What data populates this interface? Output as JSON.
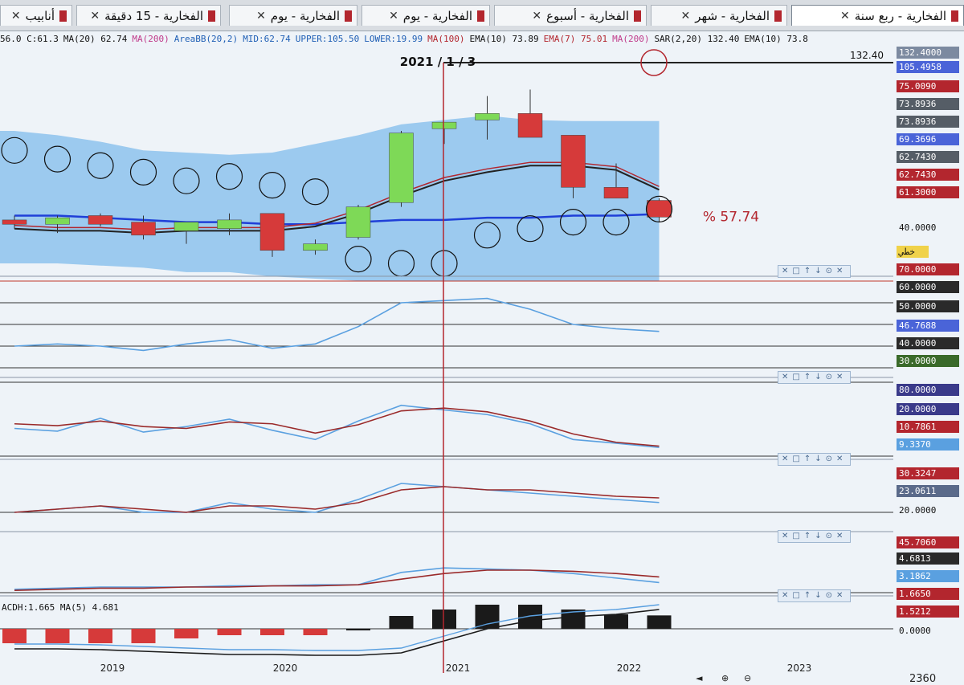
{
  "tabs": [
    {
      "label": "الفخارية - ربع سنة",
      "active": true
    },
    {
      "label": "الفخارية - شهر"
    },
    {
      "label": "الفخارية - أسبوع"
    },
    {
      "label": "الفخارية - يوم"
    },
    {
      "label": "الفخارية - يوم"
    },
    {
      "label": "الفخارية - 15 دقيقة"
    },
    {
      "label": "أنابيب"
    }
  ],
  "infobar": [
    {
      "text": "56.0 C:61.3",
      "color": "#111111"
    },
    {
      "text": "MA(20) 62.74",
      "color": "#111111"
    },
    {
      "text": "MA(200)",
      "color": "#c03a8a"
    },
    {
      "text": "AreaBB(20,2)",
      "color": "#1f5fb5"
    },
    {
      "text": "MID:62.74",
      "color": "#1f5fb5"
    },
    {
      "text": "UPPER:105.50",
      "color": "#1f5fb5"
    },
    {
      "text": "LOWER:19.99",
      "color": "#1f5fb5"
    },
    {
      "text": "MA(100)",
      "color": "#b3262e"
    },
    {
      "text": "EMA(10) 73.89",
      "color": "#111111"
    },
    {
      "text": "EMA(7) 75.01",
      "color": "#b3262e"
    },
    {
      "text": "MA(200)",
      "color": "#c03a8a"
    },
    {
      "text": "SAR(2,20) 132.40",
      "color": "#111111"
    },
    {
      "text": "EMA(10) 73.8",
      "color": "#111111"
    }
  ],
  "annotations": {
    "date_marker": "2021 / 1 / 3",
    "hline_value": "132.40",
    "percent": "% 57.74",
    "line_tool": "خطي"
  },
  "bottom": {
    "value": "2360"
  },
  "colors": {
    "bull": "#7ed957",
    "bear": "#d63a3a",
    "band": "#5aa8e8",
    "cursor": "#b3262e"
  },
  "chart_data": [
    {
      "type": "candlestick",
      "title": "الفخارية - ربع سنة",
      "x": [
        "2019",
        "2020",
        "2021",
        "2022",
        "2023"
      ],
      "ylim": [
        40,
        132.4
      ],
      "candles": [
        {
          "o": 60,
          "h": 62,
          "l": 56,
          "c": 58
        },
        {
          "o": 58,
          "h": 62,
          "l": 54,
          "c": 61
        },
        {
          "o": 62,
          "h": 63,
          "l": 57,
          "c": 58
        },
        {
          "o": 59,
          "h": 62,
          "l": 51,
          "c": 53
        },
        {
          "o": 55,
          "h": 57,
          "l": 49,
          "c": 59
        },
        {
          "o": 56,
          "h": 63,
          "l": 53,
          "c": 60
        },
        {
          "o": 63,
          "h": 63,
          "l": 43,
          "c": 46
        },
        {
          "o": 46,
          "h": 51,
          "l": 44,
          "c": 49
        },
        {
          "o": 52,
          "h": 67,
          "l": 51,
          "c": 66
        },
        {
          "o": 68,
          "h": 101,
          "l": 66,
          "c": 100
        },
        {
          "o": 102,
          "h": 104,
          "l": 95,
          "c": 105
        },
        {
          "o": 106,
          "h": 117,
          "l": 97,
          "c": 109
        },
        {
          "o": 109,
          "h": 120,
          "l": 100,
          "c": 98
        },
        {
          "o": 99,
          "h": 99,
          "l": 70,
          "c": 75
        },
        {
          "o": 75,
          "h": 86,
          "l": 70,
          "c": 70
        },
        {
          "o": 69,
          "h": 70,
          "l": 59,
          "c": 61.3
        }
      ],
      "sar": [
        92,
        88,
        85,
        82,
        78,
        80,
        76,
        73,
        42,
        40,
        40,
        53,
        56,
        59,
        59,
        65
      ],
      "bb_upper": [
        101,
        99,
        96,
        92,
        91,
        90,
        91,
        95,
        99,
        104,
        106,
        108,
        106,
        105.5,
        105.5,
        105.5
      ],
      "bb_lower": [
        40,
        40,
        39,
        38,
        36,
        36,
        34,
        33,
        32,
        32,
        32,
        32,
        32,
        32,
        32,
        32
      ],
      "ema10": [
        56,
        55,
        55,
        54,
        55,
        55,
        55,
        57,
        63,
        71,
        78,
        82,
        85,
        85,
        83,
        73.89
      ],
      "ma200": [
        62,
        62,
        61,
        60,
        59,
        59,
        58,
        58,
        59,
        60,
        60,
        61,
        61,
        62,
        62,
        62.74
      ],
      "labels": [
        "132.4000",
        "105.4958",
        "75.0090",
        "73.8936",
        "73.8936",
        "69.3696",
        "62.7430",
        "62.7430",
        "61.3000",
        "40.0000"
      ]
    },
    {
      "type": "line",
      "ylim": [
        30,
        70
      ],
      "series": [
        {
          "values": [
            40,
            41,
            40,
            38,
            41,
            43,
            39,
            41,
            49,
            60,
            61,
            62,
            57,
            50,
            48,
            46.7688
          ]
        }
      ],
      "labels": [
        "70.0000",
        "60.0000",
        "50.0000",
        "46.7688",
        "40.0000",
        "30.0000"
      ]
    },
    {
      "type": "line",
      "ylim": [
        0,
        80
      ],
      "series": [
        {
          "values": [
            30,
            27,
            41,
            26,
            32,
            40,
            28,
            18,
            38,
            55,
            50,
            45,
            35,
            18,
            14,
            9.337
          ]
        },
        {
          "values": [
            35,
            33,
            38,
            32,
            30,
            37,
            35,
            25,
            34,
            49,
            52,
            48,
            38,
            24,
            15,
            10.7861
          ]
        }
      ],
      "labels": [
        "80.0000",
        "20.0000",
        "10.7861",
        "9.3370"
      ]
    },
    {
      "type": "line",
      "ylim": [
        15,
        35
      ],
      "series": [
        {
          "values": [
            20,
            21,
            22,
            20,
            20,
            23,
            21,
            20,
            24,
            29,
            28,
            27,
            26,
            25,
            24,
            23.0611
          ]
        },
        {
          "values": [
            20,
            21,
            22,
            21,
            20,
            22,
            22,
            21,
            23,
            27,
            28,
            27,
            27,
            26,
            25,
            24.5
          ]
        }
      ],
      "labels": [
        "30.3247",
        "23.0611",
        "20.0000"
      ]
    },
    {
      "type": "line",
      "ylim": [
        0,
        50
      ],
      "series": [
        {
          "values": [
            3,
            4,
            5,
            5,
            5,
            6,
            6,
            7,
            7,
            18,
            22,
            21,
            20,
            17,
            13,
            9
          ]
        },
        {
          "values": [
            2,
            3,
            4,
            4,
            5,
            5,
            6,
            6,
            7,
            12,
            17,
            20,
            20,
            19,
            17,
            14
          ]
        }
      ],
      "labels": [
        "45.7060",
        "4.6813",
        "3.1862",
        "1.6650"
      ]
    },
    {
      "type": "bar",
      "series": [
        {
          "name": "MACDH",
          "values": [
            -1.8,
            -1.8,
            -1.8,
            -1.8,
            -1.2,
            -0.8,
            -0.8,
            -0.8,
            0,
            1.6,
            2.4,
            3.0,
            3.0,
            2.4,
            1.8,
            1.665
          ]
        },
        {
          "name": "MA(5)",
          "values": [
            -2.5,
            -2.5,
            -2.6,
            -2.8,
            -3,
            -3.2,
            -3.2,
            -3.3,
            -3.3,
            -3,
            -1.5,
            0,
            1,
            1.5,
            1.8,
            2.4
          ]
        }
      ],
      "header": "ACDH:1.665 MA(5) 4.681",
      "labels": [
        "1.5212",
        "0.0000"
      ]
    }
  ]
}
